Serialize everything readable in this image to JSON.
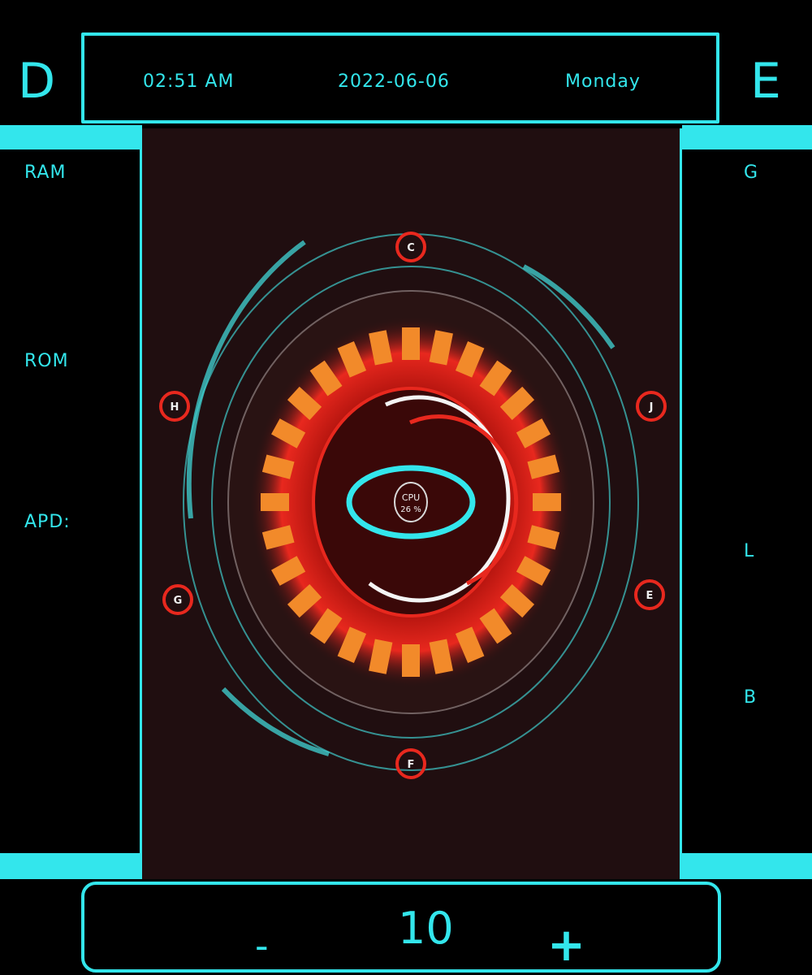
{
  "header": {
    "left_letter": "D",
    "right_letter": "E",
    "time": "02:51 AM",
    "date": "2022-06-06",
    "day": "Monday"
  },
  "left_labels": {
    "ram": "RAM",
    "rom": "ROM",
    "apd": "APD:"
  },
  "right_labels": {
    "g": "G",
    "l": "L",
    "b": "B"
  },
  "hud": {
    "top_drive": "C",
    "left_drive": "H",
    "right_drive": "J",
    "bottom_left_drive": "G",
    "bottom_right_drive": "E",
    "bottom_drive": "F",
    "center_label": "CPU",
    "center_value": "26 %"
  },
  "stepper": {
    "minus": "-",
    "value": "10",
    "plus": "+"
  },
  "colors": {
    "accent": "#33e6ec",
    "panel_bg": "#200e10",
    "core_red": "#e8281e",
    "core_orange": "#f28a2a"
  },
  "icons": {
    "center_ring": "cpu-ring-icon"
  }
}
